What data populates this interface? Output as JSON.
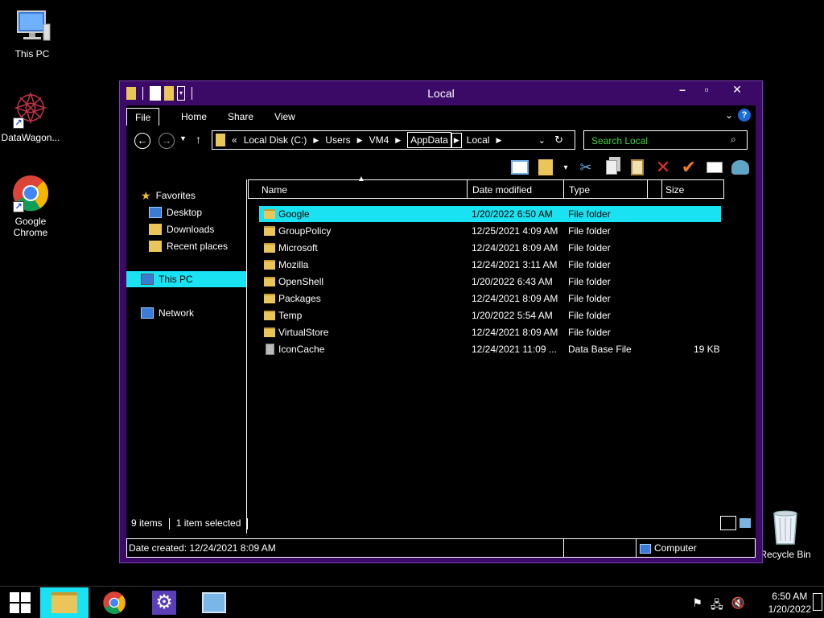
{
  "desktop": {
    "icons": [
      {
        "label": "This PC"
      },
      {
        "label": "DataWagon..."
      },
      {
        "label": "Google Chrome"
      },
      {
        "label": "Recycle Bin"
      }
    ]
  },
  "window": {
    "title": "Local",
    "ribbon_tabs": [
      "File",
      "Home",
      "Share",
      "View"
    ],
    "address": {
      "crumbs": [
        "Local Disk (C:)",
        "Users",
        "VM4",
        "AppData",
        "Local"
      ],
      "prefix": "«"
    },
    "search": {
      "placeholder": "Search Local"
    },
    "nav": {
      "favorites": "Favorites",
      "desktop": "Desktop",
      "downloads": "Downloads",
      "recent": "Recent places",
      "this_pc": "This PC",
      "network": "Network"
    },
    "columns": [
      "Name",
      "Date modified",
      "Type",
      "Size"
    ],
    "files": [
      {
        "name": "Google",
        "date": "1/20/2022 6:50 AM",
        "type": "File folder",
        "size": "",
        "kind": "folder",
        "selected": true
      },
      {
        "name": "GroupPolicy",
        "date": "12/25/2021 4:09 AM",
        "type": "File folder",
        "size": "",
        "kind": "folder"
      },
      {
        "name": "Microsoft",
        "date": "12/24/2021 8:09 AM",
        "type": "File folder",
        "size": "",
        "kind": "folder"
      },
      {
        "name": "Mozilla",
        "date": "12/24/2021 3:11 AM",
        "type": "File folder",
        "size": "",
        "kind": "folder"
      },
      {
        "name": "OpenShell",
        "date": "1/20/2022 6:43 AM",
        "type": "File folder",
        "size": "",
        "kind": "folder"
      },
      {
        "name": "Packages",
        "date": "12/24/2021 8:09 AM",
        "type": "File folder",
        "size": "",
        "kind": "folder"
      },
      {
        "name": "Temp",
        "date": "1/20/2022 5:54 AM",
        "type": "File folder",
        "size": "",
        "kind": "folder"
      },
      {
        "name": "VirtualStore",
        "date": "12/24/2021 8:09 AM",
        "type": "File folder",
        "size": "",
        "kind": "folder"
      },
      {
        "name": "IconCache",
        "date": "12/24/2021 11:09 ...",
        "type": "Data Base File",
        "size": "19 KB",
        "kind": "file"
      }
    ],
    "status": {
      "items": "9 items",
      "selected": "1 item selected"
    },
    "details": {
      "date_created": "Date created: 12/24/2021 8:09 AM",
      "location": "Computer"
    }
  },
  "taskbar": {
    "time": "6:50 AM",
    "date": "1/20/2022"
  },
  "colors": {
    "accent": "#3b0a66",
    "selection": "#19e3f2",
    "search_text": "#3dd13d"
  }
}
